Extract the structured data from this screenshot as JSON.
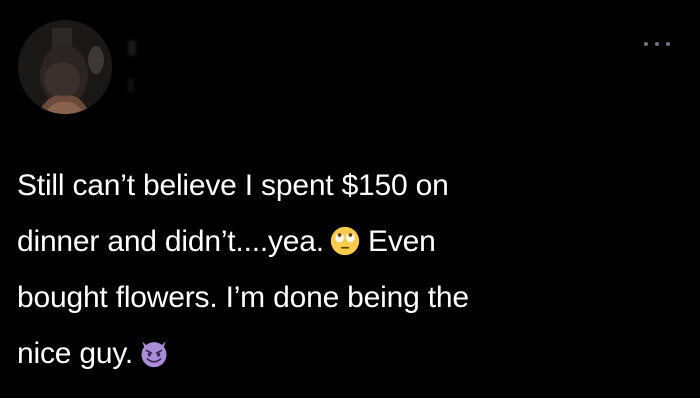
{
  "tweet": {
    "line1": "Still can’t believe I spent $150 on",
    "line2_a": "dinner and didn’t....yea.",
    "emoji_1": "eye-roll-emoji",
    "line2_b": "Even",
    "line3": "bought flowers. I’m done being the",
    "line4": "nice guy.",
    "emoji_2": "smiling-devil-emoji"
  },
  "menu": {
    "icon": "more-options-icon"
  },
  "colors": {
    "background": "#000000",
    "text": "#ffffff",
    "muted": "#6e767d",
    "devil": "#8e44ad"
  }
}
